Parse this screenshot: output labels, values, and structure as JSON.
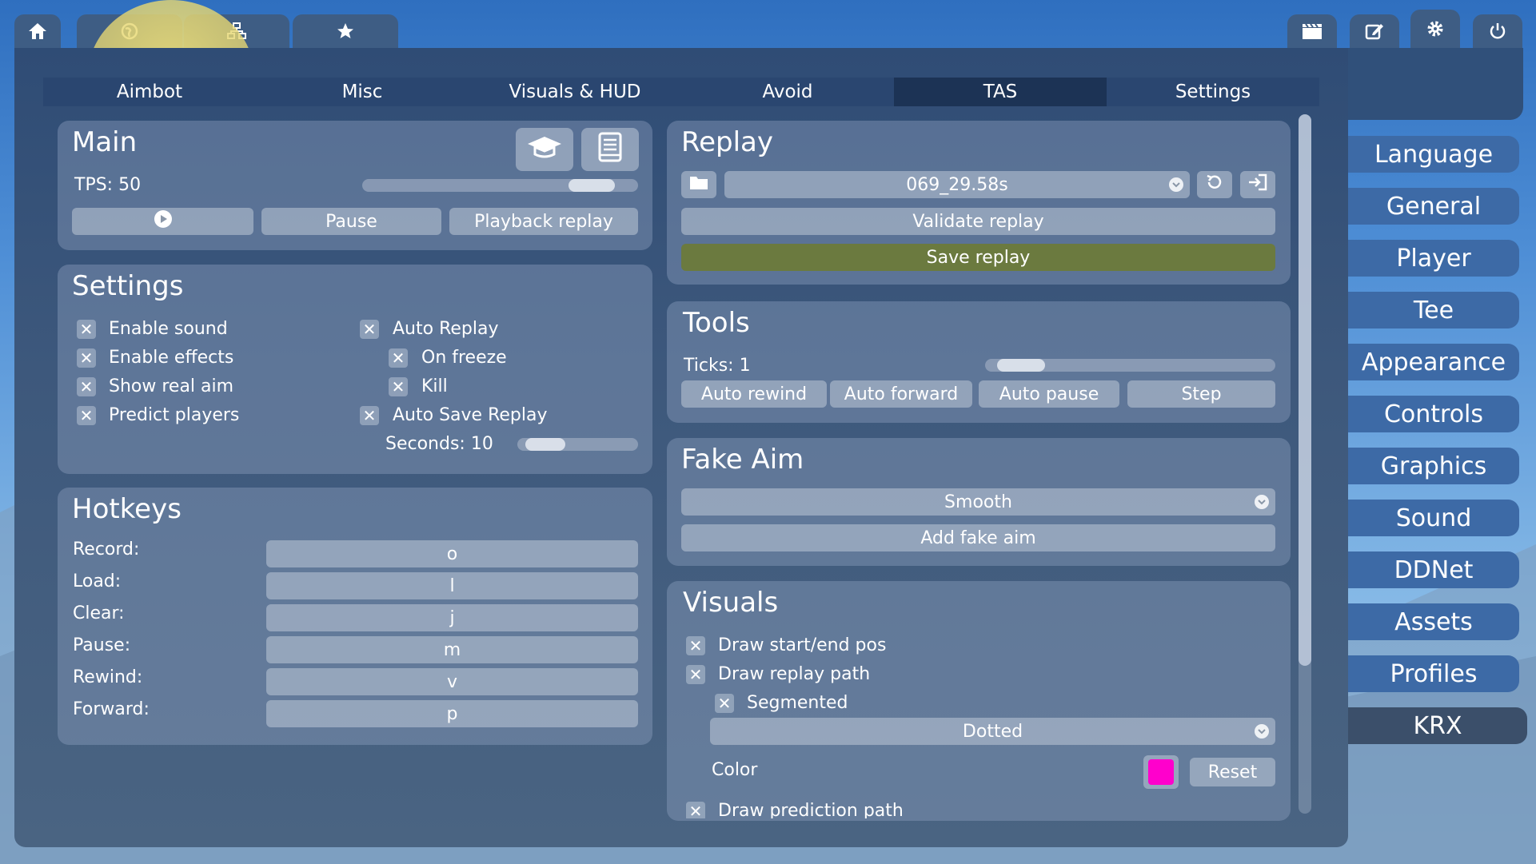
{
  "top_tabs": {
    "home": "home-icon",
    "globe": "globe-icon",
    "network": "network-icon",
    "favorites": "star-icon"
  },
  "top_right": {
    "demo": "clapperboard-icon",
    "editor": "edit-icon",
    "settings": "gear-icon",
    "quit": "power-icon"
  },
  "sub_tabs": [
    {
      "label": "Aimbot"
    },
    {
      "label": "Misc"
    },
    {
      "label": "Visuals & HUD"
    },
    {
      "label": "Avoid"
    },
    {
      "label": "TAS"
    },
    {
      "label": "Settings"
    }
  ],
  "main": {
    "title": "Main",
    "tps_label": "TPS: 50",
    "tps_fraction": 0.9,
    "play_icon": "play-icon",
    "pause_label": "Pause",
    "playback_label": "Playback replay"
  },
  "settings": {
    "title": "Settings",
    "left": [
      {
        "label": "Enable sound",
        "checked": true
      },
      {
        "label": "Enable effects",
        "checked": true
      },
      {
        "label": "Show real aim",
        "checked": true
      },
      {
        "label": "Predict players",
        "checked": true
      }
    ],
    "right": [
      {
        "label": "Auto Replay",
        "checked": true
      },
      {
        "label": "On freeze",
        "checked": true
      },
      {
        "label": "Kill",
        "checked": true
      },
      {
        "label": "Auto Save Replay",
        "checked": true
      }
    ],
    "seconds_label": "Seconds: 10",
    "seconds_fraction": 0.1
  },
  "hotkeys": {
    "title": "Hotkeys",
    "items": [
      {
        "label": "Record:",
        "key": "o"
      },
      {
        "label": "Load:",
        "key": "l"
      },
      {
        "label": "Clear:",
        "key": "j"
      },
      {
        "label": "Pause:",
        "key": "m"
      },
      {
        "label": "Rewind:",
        "key": "v"
      },
      {
        "label": "Forward:",
        "key": "p"
      }
    ]
  },
  "replay": {
    "title": "Replay",
    "selected": "069_29.58s",
    "validate_label": "Validate replay",
    "save_label": "Save replay"
  },
  "tools": {
    "title": "Tools",
    "ticks_label": "Ticks: 1",
    "ticks_fraction": 0.05,
    "buttons": [
      "Auto rewind",
      "Auto forward",
      "Auto pause",
      "Step"
    ]
  },
  "fake_aim": {
    "title": "Fake Aim",
    "mode": "Smooth",
    "add_label": "Add fake aim"
  },
  "visuals": {
    "title": "Visuals",
    "draw_start_end": "Draw start/end pos",
    "draw_replay_path": "Draw replay path",
    "segmented": "Segmented",
    "style": "Dotted",
    "color_label": "Color",
    "color_value": "#ff00cc",
    "reset_label": "Reset",
    "draw_prediction": "Draw prediction path"
  },
  "right_menu": [
    "Language",
    "General",
    "Player",
    "Tee",
    "Appearance",
    "Controls",
    "Graphics",
    "Sound",
    "DDNet",
    "Assets",
    "Profiles",
    "KRX"
  ],
  "colors": {
    "save_button": "#6b7a3f",
    "accent": "#3d6aa6"
  }
}
